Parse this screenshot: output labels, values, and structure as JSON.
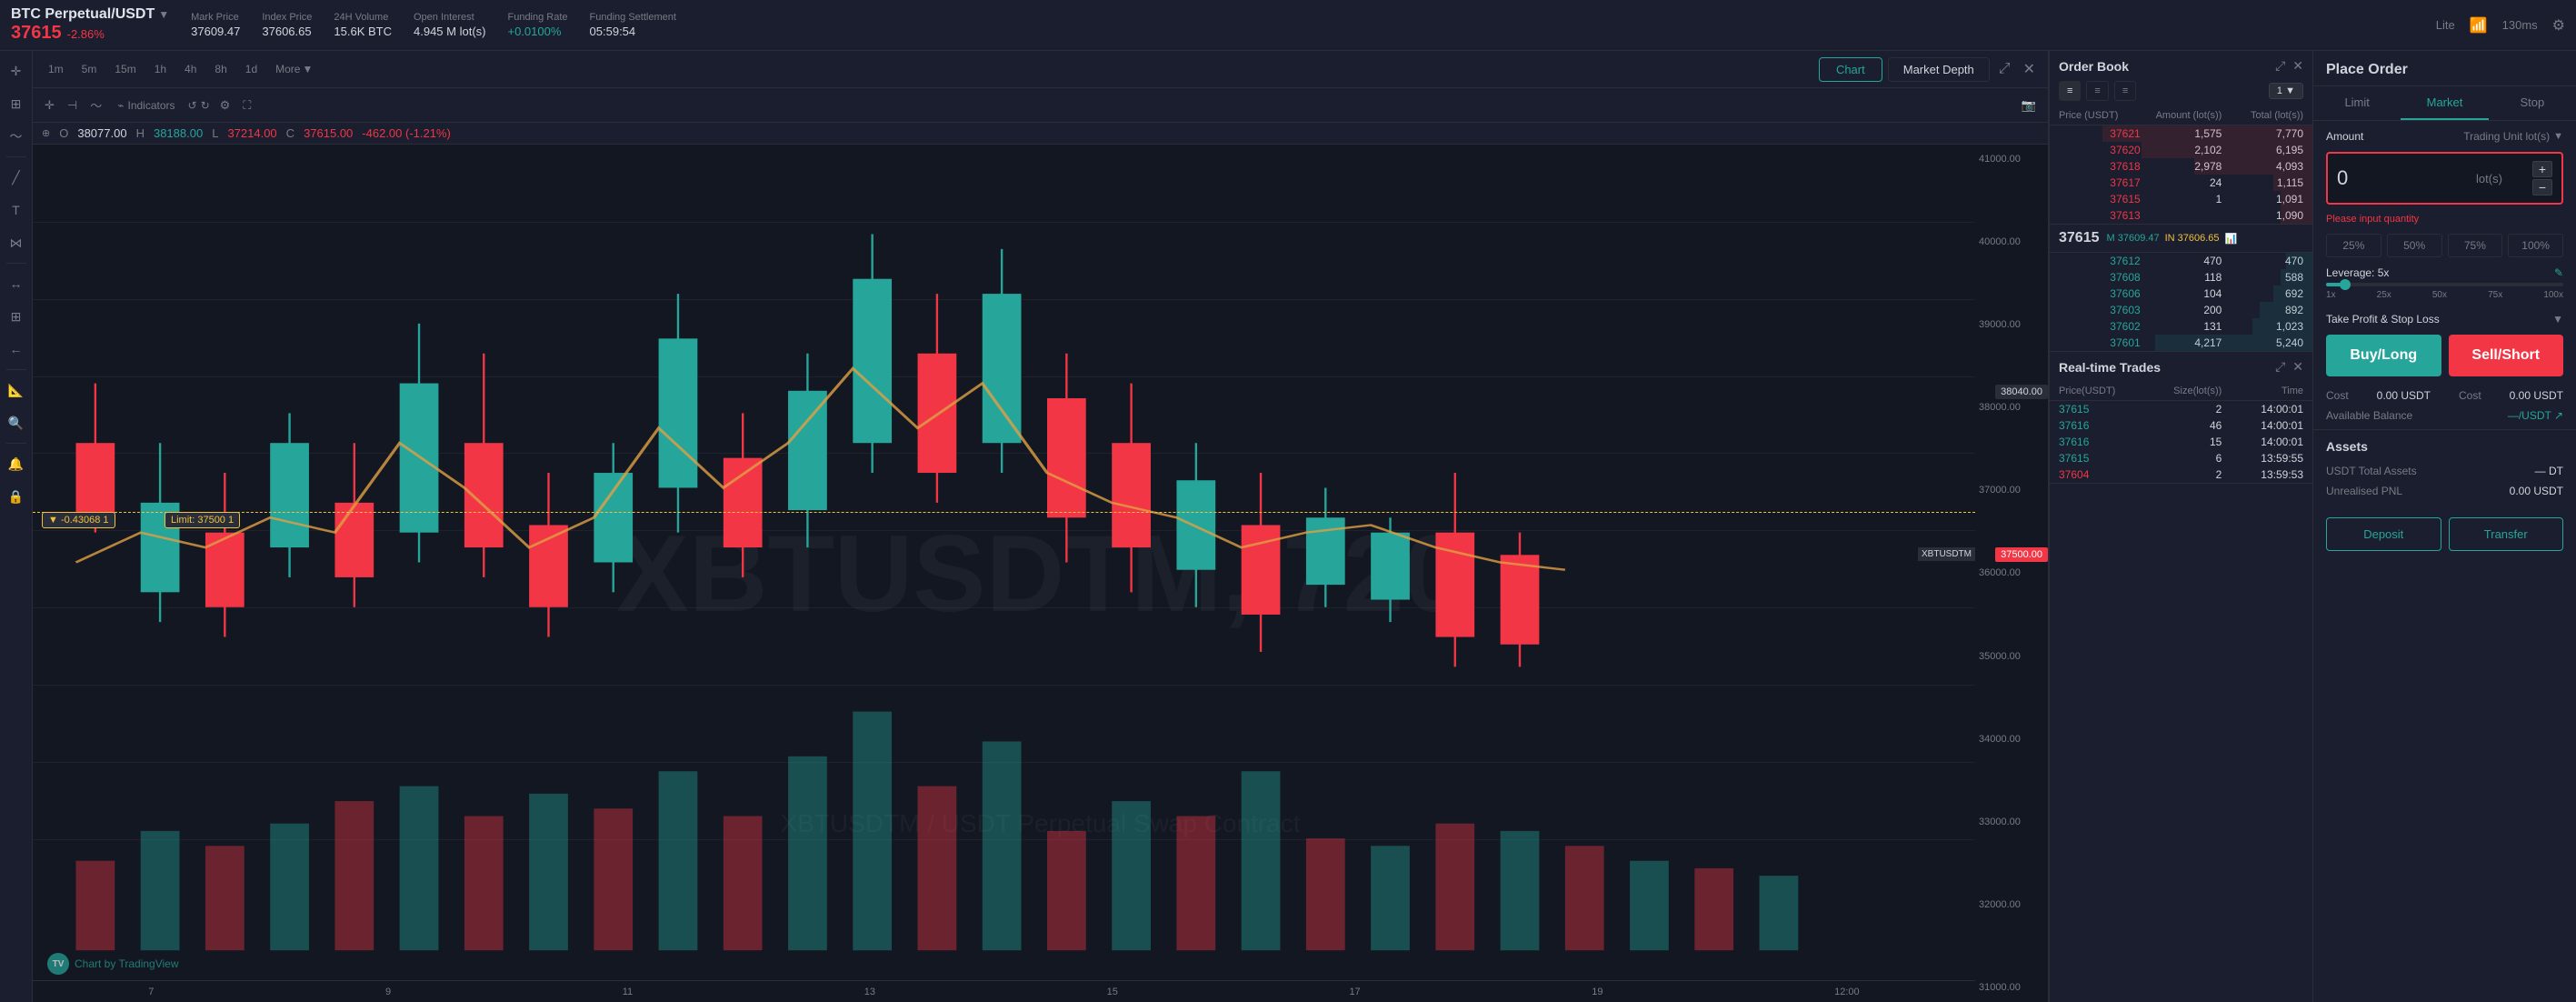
{
  "header": {
    "ticker": "BTC Perpetual/USDT",
    "arrow": "▼",
    "price": "37615",
    "price_change": "-2.86%",
    "stats": [
      {
        "label": "Mark Price",
        "value": "37609.47"
      },
      {
        "label": "Index Price",
        "value": "37606.65"
      },
      {
        "label": "24H Volume",
        "value": "15.6K BTC"
      },
      {
        "label": "Open Interest",
        "value": "4.945 M lot(s)"
      },
      {
        "label": "Funding Rate",
        "value": "+0.0100%",
        "green": true
      },
      {
        "label": "Funding Settlement",
        "value": "05:59:54"
      }
    ],
    "lite": "Lite",
    "latency": "130ms"
  },
  "chart_toolbar": {
    "timeframes": [
      "1m",
      "5m",
      "15m",
      "1h",
      "4h",
      "8h",
      "1d"
    ],
    "more": "More",
    "chart_tab": "Chart",
    "market_depth_tab": "Market Depth"
  },
  "drawing_toolbar": {
    "indicators": "Indicators"
  },
  "ohlc": {
    "open_label": "O",
    "open_val": "38077.00",
    "high_label": "H",
    "high_val": "38188.00",
    "low_label": "L",
    "low_val": "37214.00",
    "close_label": "C",
    "close_val": "37615.00",
    "change": "-462.00 (-1.21%)"
  },
  "chart": {
    "watermark": "XBTUSDTM, 720",
    "watermark2": "XBTUSDTM / USDT Perpetual Swap Contract",
    "time_labels": [
      "7",
      "9",
      "11",
      "13",
      "15",
      "17",
      "19"
    ],
    "price_labels": [
      "41000.00",
      "40000.00",
      "39000.00",
      "38000.00",
      "37000.00",
      "36000.00",
      "35000.00",
      "34000.00",
      "33000.00",
      "32000.00",
      "31000.00"
    ],
    "limit_label": "▼ -0.43068  1",
    "limit_line_text": "Limit: 37500   1",
    "price_tag_38040": "38040.00",
    "price_tag_37500": "37500.00",
    "xbtusdtm_label": "XBTUSDTM",
    "time_bottom_label": "12:00",
    "tradingview_label": "Chart by TradingView"
  },
  "orderbook": {
    "title": "Order Book",
    "columns": [
      "Price (USDT)",
      "Amount (lot(s))",
      "Total (lot(s))"
    ],
    "depth": "1",
    "sell_orders": [
      {
        "price": "37621",
        "amount": "1,575",
        "total": "7,770"
      },
      {
        "price": "37620",
        "amount": "2,102",
        "total": "6,195"
      },
      {
        "price": "37618",
        "amount": "2,978",
        "total": "4,093"
      },
      {
        "price": "37617",
        "amount": "24",
        "total": "1,115"
      },
      {
        "price": "37615",
        "amount": "1",
        "total": "1,091"
      },
      {
        "price": "37613",
        "amount": "",
        "total": "1,090"
      }
    ],
    "mid_price": "37615",
    "mid_mark": "M 37609.47",
    "mid_index": "IN 37606.65",
    "buy_orders": [
      {
        "price": "37612",
        "amount": "470",
        "total": "470"
      },
      {
        "price": "37608",
        "amount": "118",
        "total": "588"
      },
      {
        "price": "37606",
        "amount": "104",
        "total": "692"
      },
      {
        "price": "37603",
        "amount": "200",
        "total": "892"
      },
      {
        "price": "37602",
        "amount": "131",
        "total": "1,023"
      },
      {
        "price": "37601",
        "amount": "4,217",
        "total": "5,240"
      }
    ]
  },
  "real_time_trades": {
    "title": "Real-time Trades",
    "columns": [
      "Price(USDT)",
      "Size(lot(s))",
      "Time"
    ],
    "rows": [
      {
        "price": "37615",
        "size": "2",
        "time": "14:00:01",
        "buy": true
      },
      {
        "price": "37616",
        "size": "46",
        "time": "14:00:01",
        "buy": true
      },
      {
        "price": "37616",
        "size": "15",
        "time": "14:00:01",
        "buy": true
      },
      {
        "price": "37615",
        "size": "6",
        "time": "13:59:55",
        "buy": true
      },
      {
        "price": "37604",
        "size": "2",
        "time": "13:59:53",
        "buy": false
      }
    ]
  },
  "order_panel": {
    "title": "Place Order",
    "tabs": [
      "Limit",
      "Market",
      "Stop"
    ],
    "active_tab": 1,
    "amount_label": "Amount",
    "trading_unit": "Trading Unit lot(s)",
    "amount_placeholder": "0",
    "amount_unit": "lot(s)",
    "error_text": "Please input quantity",
    "pct_buttons": [
      "25%",
      "50%",
      "75%",
      "100%"
    ],
    "leverage_label": "Leverage: 5x",
    "leverage_edit_icon": "✎",
    "leverage_ticks": [
      "1x",
      "25x",
      "50x",
      "75x",
      "100x"
    ],
    "tp_sl_label": "Take Profit & Stop Loss",
    "buy_btn": "Buy/Long",
    "sell_btn": "Sell/Short",
    "cost_buy_label": "Cost",
    "cost_buy_val": "0.00 USDT",
    "cost_sell_label": "Cost",
    "cost_sell_val": "0.00 USDT",
    "avail_label": "Available Balance",
    "avail_val": "—/USDT ↗",
    "assets_title": "Assets",
    "usdt_label": "USDT Total Assets",
    "usdt_val": "— DT",
    "pnl_label": "Unrealised PNL",
    "pnl_val": "0.00 USDT",
    "deposit_btn": "Deposit",
    "transfer_btn": "Transfer"
  }
}
